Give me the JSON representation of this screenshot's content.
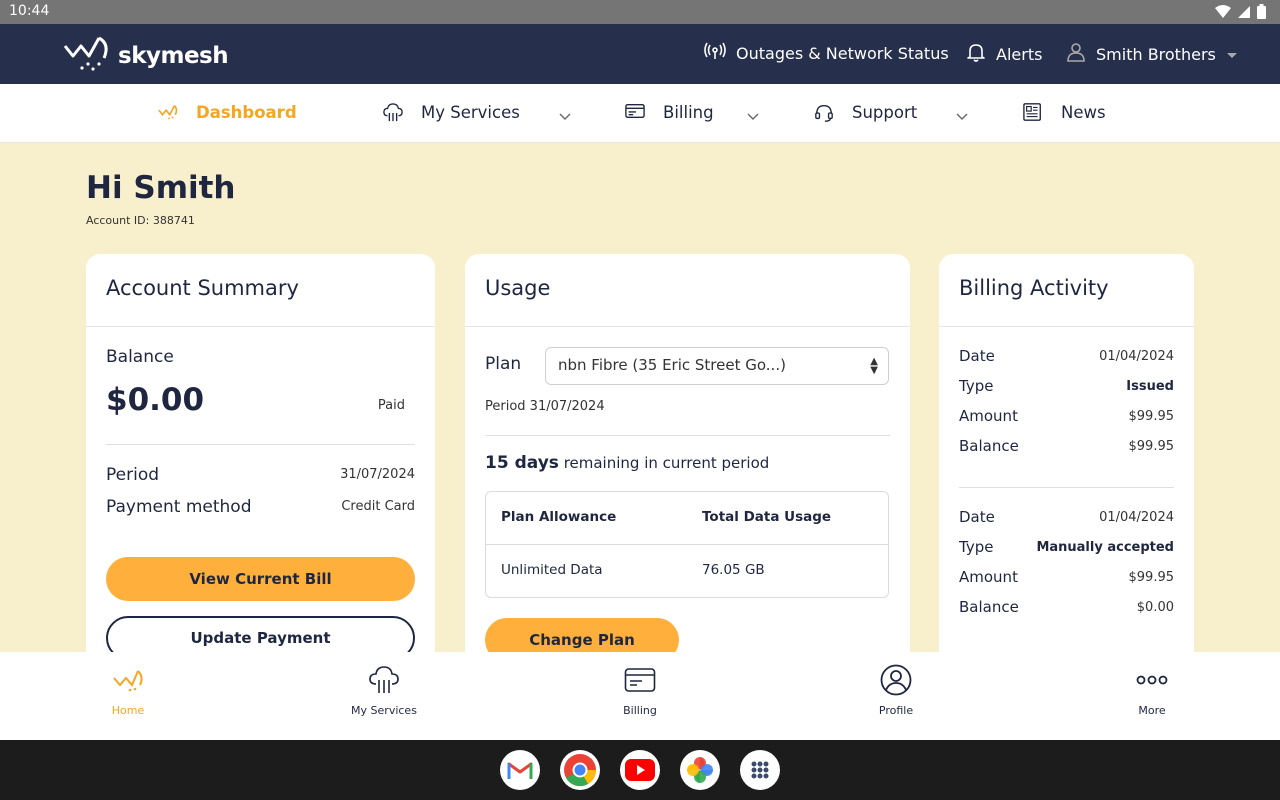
{
  "status_bar": {
    "time": "10:44"
  },
  "header": {
    "brand": "skymesh",
    "outages_label": "Outages & Network Status",
    "alerts_label": "Alerts",
    "user_label": "Smith Brothers"
  },
  "nav": {
    "dashboard": "Dashboard",
    "my_services": "My Services",
    "billing": "Billing",
    "support": "Support",
    "news": "News"
  },
  "greeting": "Hi Smith",
  "account_id": "Account ID: 388741",
  "account_summary": {
    "title": "Account Summary",
    "balance_label": "Balance",
    "balance_value": "$0.00",
    "balance_status": "Paid",
    "period_label": "Period",
    "period_value": "31/07/2024",
    "payment_method_label": "Payment method",
    "payment_method_value": "Credit Card",
    "view_bill_button": "View Current Bill",
    "update_payment_button": "Update Payment"
  },
  "usage": {
    "title": "Usage",
    "plan_label": "Plan",
    "plan_selected": "nbn Fibre (35 Eric Street Go...)",
    "period": "Period 31/07/2024",
    "days_remaining": "15 days",
    "remaining_text": "remaining in current period",
    "table_headers": [
      "Plan Allowance",
      "Total Data Usage"
    ],
    "table_row": [
      "Unlimited Data",
      "76.05 GB"
    ],
    "change_plan_button": "Change Plan"
  },
  "billing_activity": {
    "title": "Billing Activity",
    "labels": {
      "date": "Date",
      "type": "Type",
      "amount": "Amount",
      "balance": "Balance"
    },
    "entries": [
      {
        "date": "01/04/2024",
        "type": "Issued",
        "amount": "$99.95",
        "balance": "$99.95"
      },
      {
        "date": "01/04/2024",
        "type": "Manually accepted",
        "amount": "$99.95",
        "balance": "$0.00"
      }
    ]
  },
  "bottom_nav": {
    "home": "Home",
    "my_services": "My Services",
    "billing": "Billing",
    "profile": "Profile",
    "more": "More"
  },
  "colors": {
    "accent": "#ffb03c",
    "navy": "#262f4b",
    "background": "#f8efcc"
  }
}
